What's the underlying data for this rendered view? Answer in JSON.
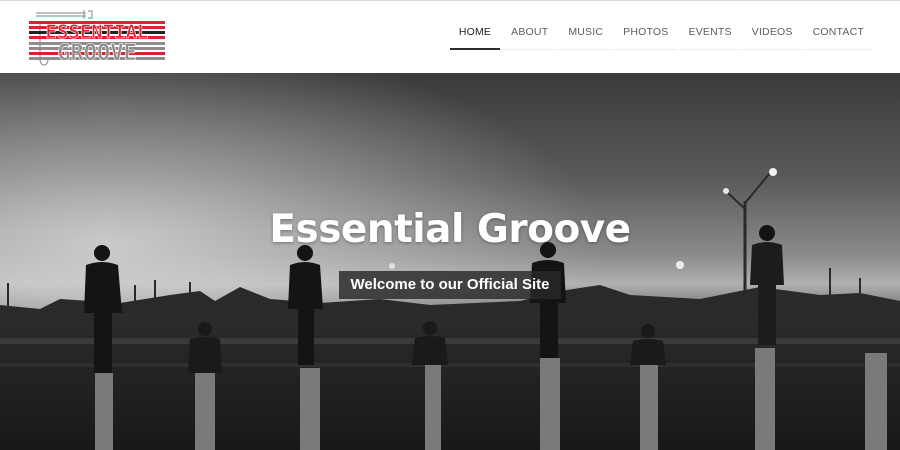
{
  "logo": {
    "line1": "ESSENTIAL",
    "line2": "GROOVE",
    "colors": {
      "red": "#e0202e",
      "gray": "#8d8d8d",
      "dark": "#222222"
    },
    "icon": "trumpet-icon"
  },
  "nav": {
    "items": [
      {
        "label": "HOME",
        "active": true
      },
      {
        "label": "ABOUT",
        "active": false
      },
      {
        "label": "MUSIC",
        "active": false
      },
      {
        "label": "PHOTOS",
        "active": false
      },
      {
        "label": "EVENTS",
        "active": false
      },
      {
        "label": "VIDEOS",
        "active": false
      },
      {
        "label": "CONTACT",
        "active": false
      }
    ]
  },
  "hero": {
    "title": "Essential Groove",
    "subtitle": "Welcome to our Official Site",
    "photo_style": "black-and-white"
  }
}
